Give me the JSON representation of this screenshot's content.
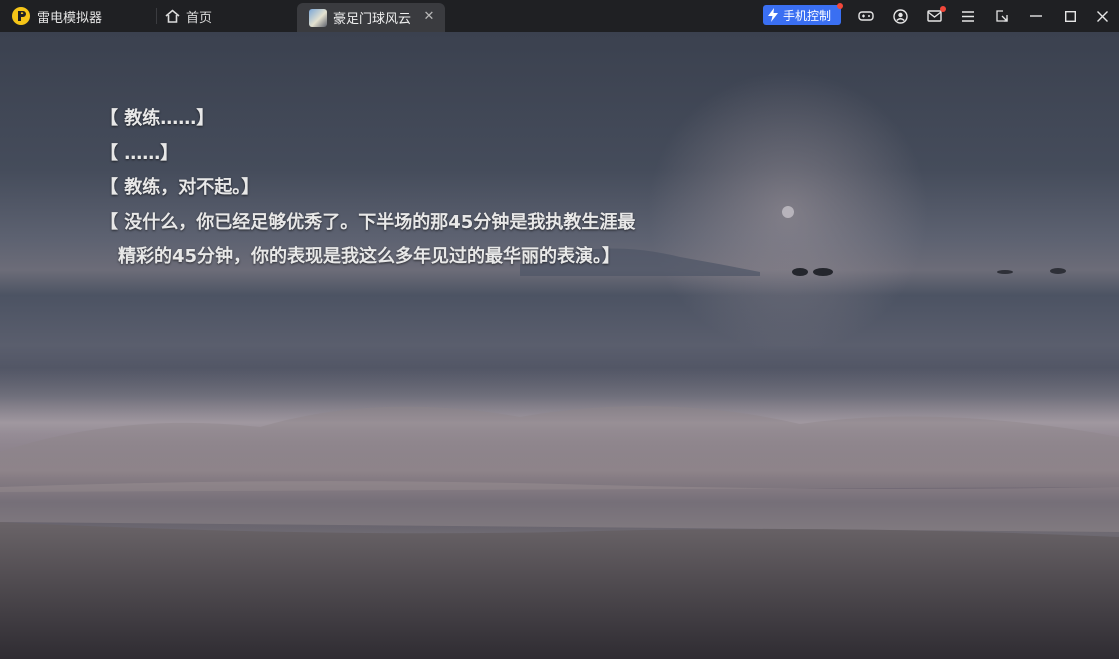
{
  "app": {
    "name": "雷电模拟器"
  },
  "tabs": [
    {
      "label": "首页",
      "icon": "home-icon"
    },
    {
      "label": "豪足门球风云",
      "icon": "game-icon",
      "active": true
    }
  ],
  "toolbar": {
    "phone_control_label": "手机控制",
    "accent": "#3a6ff2"
  },
  "dialog": {
    "lines": [
      "【 教练……】",
      "【 ……】",
      "【 教练，对不起。】",
      "【 没什么，你已经足够优秀了。下半场的那45分钟是我执教生涯最精彩的45分钟，你的表现是我这么多年见过的最华丽的表演。】"
    ]
  }
}
